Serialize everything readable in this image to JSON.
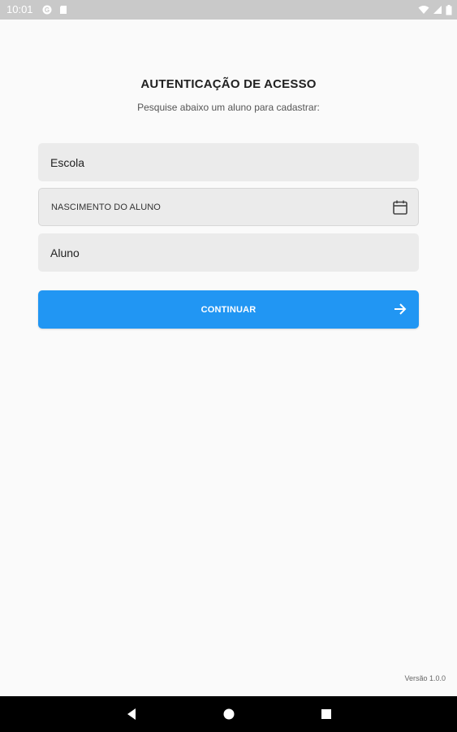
{
  "status_bar": {
    "time": "10:01",
    "icons": [
      "notification-g-icon",
      "sd-card-icon",
      "wifi-icon",
      "signal-icon",
      "battery-icon"
    ]
  },
  "header": {
    "title": "AUTENTICAÇÃO DE ACESSO",
    "subtitle": "Pesquise abaixo um aluno para cadastrar:"
  },
  "form": {
    "school_placeholder": "Escola",
    "birth_placeholder": "NASCIMENTO DO ALUNO",
    "student_placeholder": "Aluno",
    "continue_label": "CONTINUAR"
  },
  "footer": {
    "version": "Versão 1.0.0"
  },
  "nav_bar": {
    "buttons": [
      "back-icon",
      "home-icon",
      "recents-icon"
    ]
  },
  "colors": {
    "accent": "#2196f3",
    "field_bg": "#ebebeb",
    "page_bg": "#fafafa",
    "status_bar": "#c9c9c9",
    "nav_bar": "#000000"
  }
}
